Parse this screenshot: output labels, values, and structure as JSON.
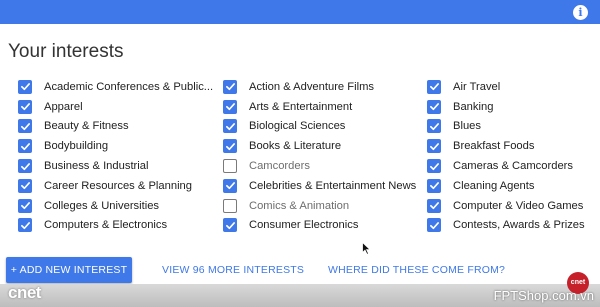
{
  "header": {
    "info_icon": "i"
  },
  "title": "Your interests",
  "columns": [
    [
      {
        "label": "Academic Conferences & Public...",
        "checked": true
      },
      {
        "label": "Apparel",
        "checked": true
      },
      {
        "label": "Beauty & Fitness",
        "checked": true
      },
      {
        "label": "Bodybuilding",
        "checked": true
      },
      {
        "label": "Business & Industrial",
        "checked": true
      },
      {
        "label": "Career Resources & Planning",
        "checked": true
      },
      {
        "label": "Colleges & Universities",
        "checked": true
      },
      {
        "label": "Computers & Electronics",
        "checked": true
      }
    ],
    [
      {
        "label": "Action & Adventure Films",
        "checked": true
      },
      {
        "label": "Arts & Entertainment",
        "checked": true
      },
      {
        "label": "Biological Sciences",
        "checked": true
      },
      {
        "label": "Books & Literature",
        "checked": true
      },
      {
        "label": "Camcorders",
        "checked": false
      },
      {
        "label": "Celebrities & Entertainment News",
        "checked": true
      },
      {
        "label": "Comics & Animation",
        "checked": false
      },
      {
        "label": "Consumer Electronics",
        "checked": true
      }
    ],
    [
      {
        "label": "Air Travel",
        "checked": true
      },
      {
        "label": "Banking",
        "checked": true
      },
      {
        "label": "Blues",
        "checked": true
      },
      {
        "label": "Breakfast Foods",
        "checked": true
      },
      {
        "label": "Cameras & Camcorders",
        "checked": true
      },
      {
        "label": "Cleaning Agents",
        "checked": true
      },
      {
        "label": "Computer & Video Games",
        "checked": true
      },
      {
        "label": "Contests, Awards & Prizes",
        "checked": true
      }
    ]
  ],
  "footer": {
    "add_button": "+ ADD NEW INTEREST",
    "more_link": "VIEW 96 MORE INTERESTS",
    "where_link": "WHERE DID THESE COME FROM?"
  },
  "overlay": {
    "cnet_logo": "cnet",
    "cnet_badge": "cnet",
    "watermark": "FPTShop.com.vn"
  },
  "colors": {
    "accent": "#3f78e8",
    "text": "#222222",
    "muted": "#6e6e6e"
  }
}
